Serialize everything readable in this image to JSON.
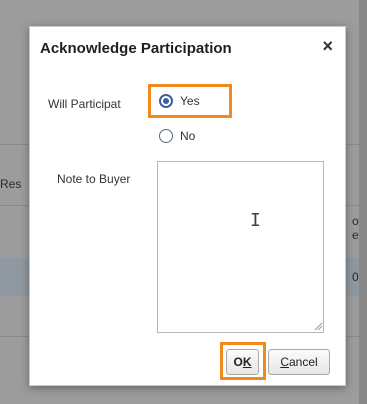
{
  "background": {
    "left_fragment": "Res",
    "right_fragment_1": "oti",
    "right_fragment_2": "e",
    "right_fragment_3": "0"
  },
  "dialog": {
    "title": "Acknowledge Participation",
    "close_symbol": "×",
    "participate_label": "Will Participat",
    "options": {
      "yes": "Yes",
      "no": "No"
    },
    "selected_option": "Yes",
    "note_label": "Note to Buyer",
    "note_value": "",
    "ok_button": {
      "underlined": "K",
      "prefix": "O"
    },
    "cancel_button": {
      "underlined": "C",
      "rest": "ancel"
    }
  },
  "colors": {
    "highlight": "#f08a1c",
    "radio_accent": "#3f5f9e"
  },
  "icons": {
    "close": "close-icon",
    "cursor": "text-cursor-icon",
    "resize": "resize-grip-icon"
  }
}
